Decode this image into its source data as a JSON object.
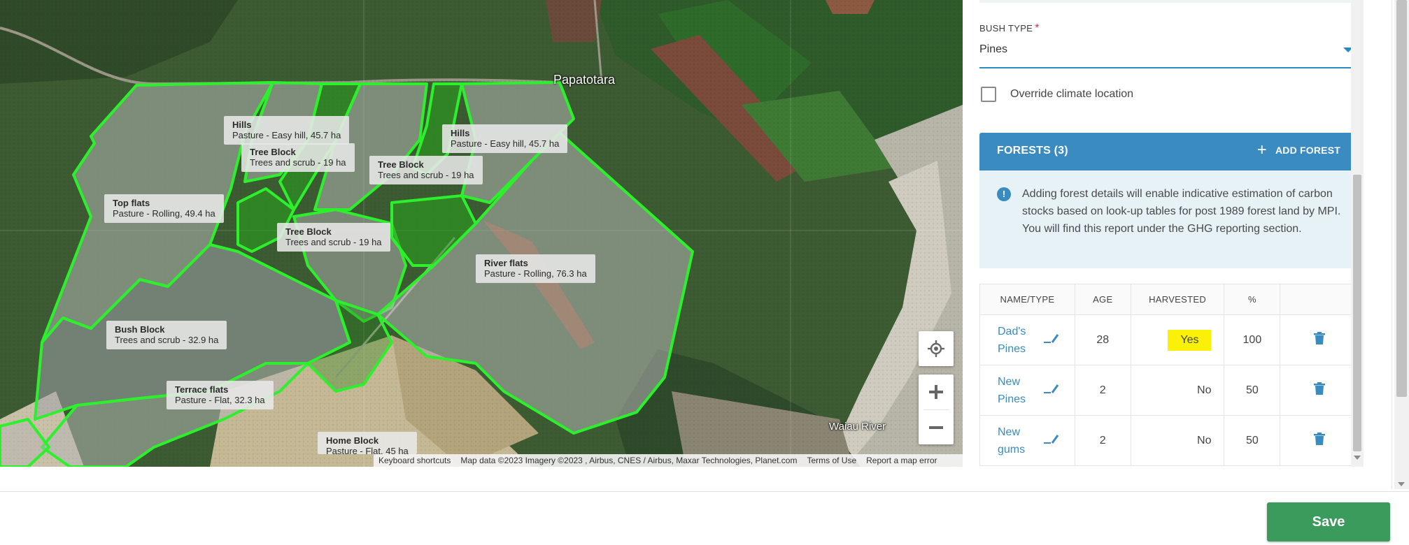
{
  "map": {
    "place_labels": {
      "papatotara": "Papatotara",
      "waiau_river": "Waiau River"
    },
    "paddocks": [
      {
        "name": "Hills",
        "detail": "Pasture - Easy hill, 45.7 ha"
      },
      {
        "name": "Tree Block",
        "detail": "Trees and scrub - 19 ha"
      },
      {
        "name": "Tree Block",
        "detail": "Trees and scrub - 19 ha"
      },
      {
        "name": "Hills",
        "detail": "Pasture - Easy hill, 45.7 ha"
      },
      {
        "name": "Top flats",
        "detail": "Pasture - Rolling, 49.4 ha"
      },
      {
        "name": "Tree Block",
        "detail": "Trees and scrub - 19 ha"
      },
      {
        "name": "River flats",
        "detail": "Pasture - Rolling, 76.3 ha"
      },
      {
        "name": "Bush Block",
        "detail": "Trees and scrub - 32.9 ha"
      },
      {
        "name": "Terrace flats",
        "detail": "Pasture - Flat, 32.3 ha"
      },
      {
        "name": "Home Block",
        "detail": "Pasture - Flat, 45 ha"
      }
    ],
    "attribution": {
      "shortcuts": "Keyboard shortcuts",
      "data": "Map data ©2023 Imagery ©2023 , Airbus, CNES / Airbus, Maxar Technologies, Planet.com",
      "terms": "Terms of Use",
      "report": "Report a map error"
    },
    "controls": {
      "locate_icon": "crosshair-icon",
      "zoom_in": "+",
      "zoom_out": "−"
    },
    "colors": {
      "boundary": "#2df02d",
      "overlay": "#b4b4b4"
    }
  },
  "panel": {
    "bush_type": {
      "label": "BUSH TYPE",
      "required_mark": "*",
      "value": "Pines"
    },
    "override_climate": {
      "label": "Override climate location",
      "checked": false
    },
    "forests": {
      "title": "FORESTS (3)",
      "add_label": "ADD FOREST",
      "info_text": "Adding forest details will enable indicative estimation of carbon stocks based on look-up tables for post 1989 forest land by MPI. You will find this report under the GHG reporting section.",
      "columns": [
        "NAME/TYPE",
        "AGE",
        "HARVESTED",
        "%"
      ],
      "rows": [
        {
          "name": "Dad's Pines",
          "age": "28",
          "harvested": "Yes",
          "percent": "100"
        },
        {
          "name": "New Pines",
          "age": "2",
          "harvested": "No",
          "percent": "50"
        },
        {
          "name": "New gums",
          "age": "2",
          "harvested": "No",
          "percent": "50"
        }
      ]
    },
    "colors": {
      "accent": "#3a8cc0",
      "highlight": "#fbf007",
      "delete": "#3a8cc0"
    }
  },
  "footer": {
    "save_label": "Save",
    "save_color": "#3b9b5c"
  }
}
